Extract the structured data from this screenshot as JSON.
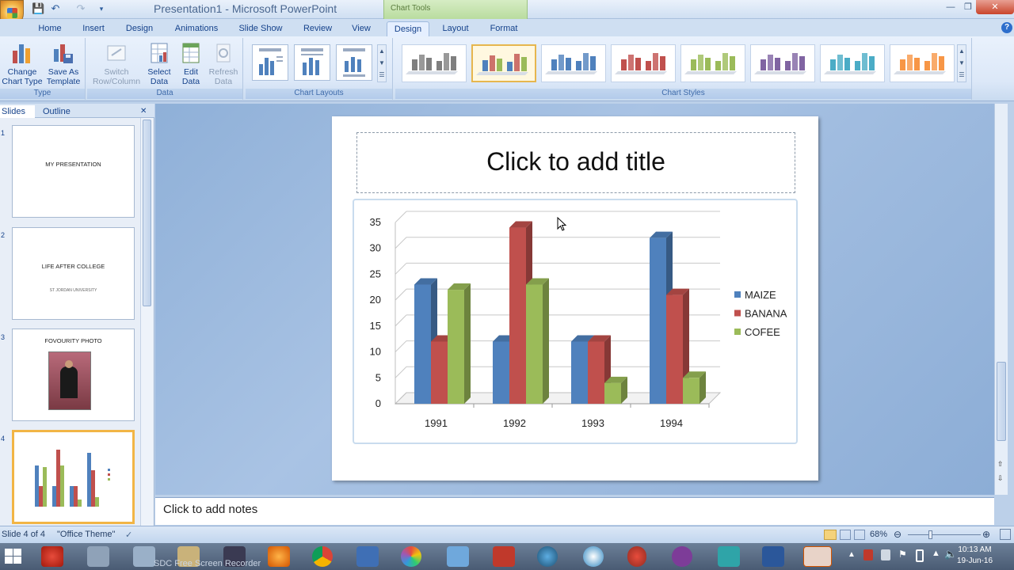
{
  "window": {
    "title": "Presentation1 - Microsoft PowerPoint",
    "context_tab_group": "Chart Tools"
  },
  "tabs": [
    "Home",
    "Insert",
    "Design",
    "Animations",
    "Slide Show",
    "Review",
    "View",
    "Design",
    "Layout",
    "Format"
  ],
  "active_tab_index": 7,
  "ribbon": {
    "type_group": {
      "label": "Type",
      "change_chart_type": "Change Chart Type",
      "save_as_template": "Save As Template"
    },
    "data_group": {
      "label": "Data",
      "switch_row_column": "Switch Row/Column",
      "select_data": "Select Data",
      "edit_data": "Edit Data",
      "refresh_data": "Refresh Data"
    },
    "layouts_group": {
      "label": "Chart Layouts"
    },
    "styles_group": {
      "label": "Chart Styles",
      "style_colors": [
        "#7f7f7f",
        "#4f81bd",
        "#4f81bd",
        "#c0504d",
        "#9bbb59",
        "#8064a2",
        "#4bacc6",
        "#f79646"
      ],
      "selected_style_index": 1
    }
  },
  "slide_pane": {
    "tabs": {
      "slides": "Slides",
      "outline": "Outline"
    },
    "thumbnails": [
      {
        "number": "1",
        "title": "MY PRESENTATION",
        "subtitle": ""
      },
      {
        "number": "2",
        "title": "LIFE AFTER COLLEGE",
        "subtitle": "ST JORDAN UNIVERSITY"
      },
      {
        "number": "3",
        "title": "FOVOURITY PHOTO",
        "subtitle": ""
      },
      {
        "number": "4",
        "title": "",
        "subtitle": ""
      }
    ]
  },
  "slide": {
    "title_placeholder": "Click to add title"
  },
  "notes": {
    "placeholder": "Click to add notes"
  },
  "chart_data": {
    "type": "bar",
    "categories": [
      "1991",
      "1992",
      "1993",
      "1994"
    ],
    "series": [
      {
        "name": "MAIZE",
        "values": [
          23,
          12,
          12,
          32
        ],
        "color": "#4f81bd"
      },
      {
        "name": "BANANA",
        "values": [
          12,
          34,
          12,
          21
        ],
        "color": "#c0504d"
      },
      {
        "name": "COFEE",
        "values": [
          22,
          23,
          4,
          5
        ],
        "color": "#9bbb59"
      }
    ],
    "title": "",
    "xlabel": "",
    "ylabel": "",
    "ylim": [
      0,
      35
    ],
    "yticks": [
      0,
      5,
      10,
      15,
      20,
      25,
      30,
      35
    ],
    "grid": true,
    "legend": "right",
    "style": "3-D clustered column"
  },
  "statusbar": {
    "slide_info": "Slide 4 of 4",
    "theme": "\"Office Theme\"",
    "zoom": "68%"
  },
  "taskbar": {
    "clock_time": "10:13 AM",
    "clock_date": "19-Jun-16",
    "background_app": "SDC Free Screen Recorder"
  }
}
